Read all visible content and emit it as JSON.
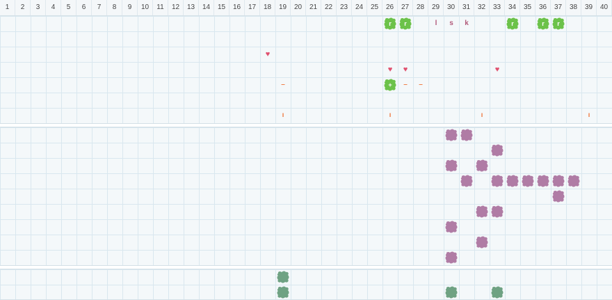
{
  "columns": [
    "1",
    "2",
    "3",
    "4",
    "5",
    "6",
    "7",
    "8",
    "9",
    "10",
    "11",
    "12",
    "13",
    "14",
    "15",
    "16",
    "17",
    "18",
    "19",
    "20",
    "21",
    "22",
    "23",
    "24",
    "25",
    "26",
    "27",
    "28",
    "29",
    "30",
    "31",
    "32",
    "33",
    "34",
    "35",
    "36",
    "37",
    "38",
    "39",
    "40"
  ],
  "colors": {
    "green": "#6cc24a",
    "purple": "#b07ca5",
    "teal_green": "#6fa283",
    "pink": "#e0506e",
    "orange": "#ef7d45",
    "letter": "#b25a7a",
    "grid": "#d9e7ef",
    "background": "#f4f8fa"
  },
  "tracks": [
    {
      "name": "track-1",
      "cells": [
        {
          "col": 26,
          "row": 1,
          "kind": "blob",
          "color": "green",
          "mark": "r"
        },
        {
          "col": 27,
          "row": 1,
          "kind": "blob",
          "color": "green",
          "mark": "r"
        },
        {
          "col": 29,
          "row": 1,
          "kind": "letter",
          "text": "l"
        },
        {
          "col": 30,
          "row": 1,
          "kind": "letter",
          "text": "s"
        },
        {
          "col": 31,
          "row": 1,
          "kind": "letter",
          "text": "k"
        },
        {
          "col": 34,
          "row": 1,
          "kind": "blob",
          "color": "green",
          "mark": "r"
        },
        {
          "col": 36,
          "row": 1,
          "kind": "blob",
          "color": "green",
          "mark": "r"
        },
        {
          "col": 37,
          "row": 1,
          "kind": "blob",
          "color": "green",
          "mark": "r"
        },
        {
          "col": 18,
          "row": 3,
          "kind": "heart",
          "text": "♥"
        },
        {
          "col": 26,
          "row": 4,
          "kind": "heart",
          "text": "♥"
        },
        {
          "col": 27,
          "row": 4,
          "kind": "heart",
          "text": "♥"
        },
        {
          "col": 33,
          "row": 4,
          "kind": "heart",
          "text": "♥"
        },
        {
          "col": 19,
          "row": 5,
          "kind": "dash",
          "text": "–"
        },
        {
          "col": 26,
          "row": 5,
          "kind": "blob",
          "color": "green",
          "mark": "+"
        },
        {
          "col": 27,
          "row": 5,
          "kind": "dash",
          "text": "–"
        },
        {
          "col": 28,
          "row": 5,
          "kind": "dash",
          "text": "–"
        },
        {
          "col": 19,
          "row": 7,
          "kind": "tick",
          "text": "ı"
        },
        {
          "col": 26,
          "row": 7,
          "kind": "tick",
          "text": "ı"
        },
        {
          "col": 32,
          "row": 7,
          "kind": "tick",
          "text": "ı"
        },
        {
          "col": 39,
          "row": 7,
          "kind": "tick",
          "text": "ı"
        }
      ]
    },
    {
      "name": "track-2",
      "cells": [
        {
          "col": 30,
          "row": 1,
          "kind": "blob",
          "color": "purple"
        },
        {
          "col": 31,
          "row": 1,
          "kind": "blob",
          "color": "purple"
        },
        {
          "col": 33,
          "row": 2,
          "kind": "blob",
          "color": "purple"
        },
        {
          "col": 30,
          "row": 3,
          "kind": "blob",
          "color": "purple"
        },
        {
          "col": 32,
          "row": 3,
          "kind": "blob",
          "color": "purple"
        },
        {
          "col": 31,
          "row": 4,
          "kind": "blob",
          "color": "purple"
        },
        {
          "col": 33,
          "row": 4,
          "kind": "blob",
          "color": "purple"
        },
        {
          "col": 34,
          "row": 4,
          "kind": "blob",
          "color": "purple"
        },
        {
          "col": 35,
          "row": 4,
          "kind": "blob",
          "color": "purple"
        },
        {
          "col": 36,
          "row": 4,
          "kind": "blob",
          "color": "purple"
        },
        {
          "col": 37,
          "row": 4,
          "kind": "blob",
          "color": "purple"
        },
        {
          "col": 38,
          "row": 4,
          "kind": "blob",
          "color": "purple"
        },
        {
          "col": 37,
          "row": 5,
          "kind": "blob",
          "color": "purple"
        },
        {
          "col": 32,
          "row": 6,
          "kind": "blob",
          "color": "purple"
        },
        {
          "col": 33,
          "row": 6,
          "kind": "blob",
          "color": "purple"
        },
        {
          "col": 30,
          "row": 7,
          "kind": "blob",
          "color": "purple"
        },
        {
          "col": 32,
          "row": 8,
          "kind": "blob",
          "color": "purple"
        },
        {
          "col": 30,
          "row": 9,
          "kind": "blob",
          "color": "purple"
        }
      ]
    },
    {
      "name": "track-3",
      "cells": [
        {
          "col": 19,
          "row": 1,
          "kind": "blob",
          "color": "teal_green"
        },
        {
          "col": 19,
          "row": 2,
          "kind": "blob",
          "color": "teal_green"
        },
        {
          "col": 30,
          "row": 2,
          "kind": "blob",
          "color": "teal_green"
        },
        {
          "col": 33,
          "row": 2,
          "kind": "blob",
          "color": "teal_green"
        }
      ]
    }
  ]
}
